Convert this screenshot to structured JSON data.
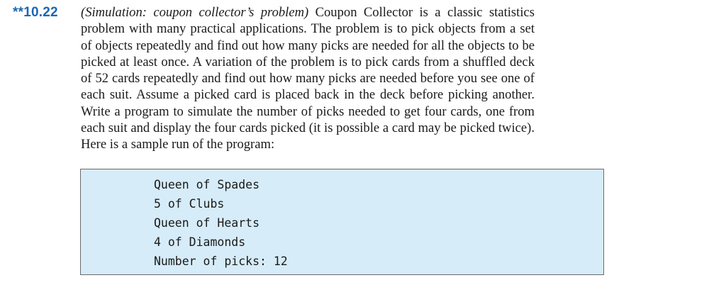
{
  "exercise": {
    "number": "**10.22",
    "topic": "(Simulation: coupon collector’s problem)",
    "body": " Coupon Collector is a classic statistics problem with many practical applications. The problem is to pick objects from a set of objects repeatedly and find out how many picks are needed for all the objects to be picked at least once. A variation of the problem is to pick cards from a shuffled deck of 52 cards repeatedly and find out how many picks are needed before you see one of each suit. Assume a picked card is placed back in the deck before picking another. Write a program to simulate the number of picks needed to get four cards, one from each suit and display the four cards picked (it is possible a card may be picked twice). Here is a sample run of the program:"
  },
  "sample_run": {
    "lines": [
      "Queen of Spades",
      "5 of Clubs",
      "Queen of Hearts",
      "4 of Diamonds",
      "Number of picks: 12"
    ]
  },
  "colors": {
    "exercise_number": "#1b67b3",
    "sample_background": "#d6ecf8",
    "sample_border": "#6b6b6b"
  }
}
